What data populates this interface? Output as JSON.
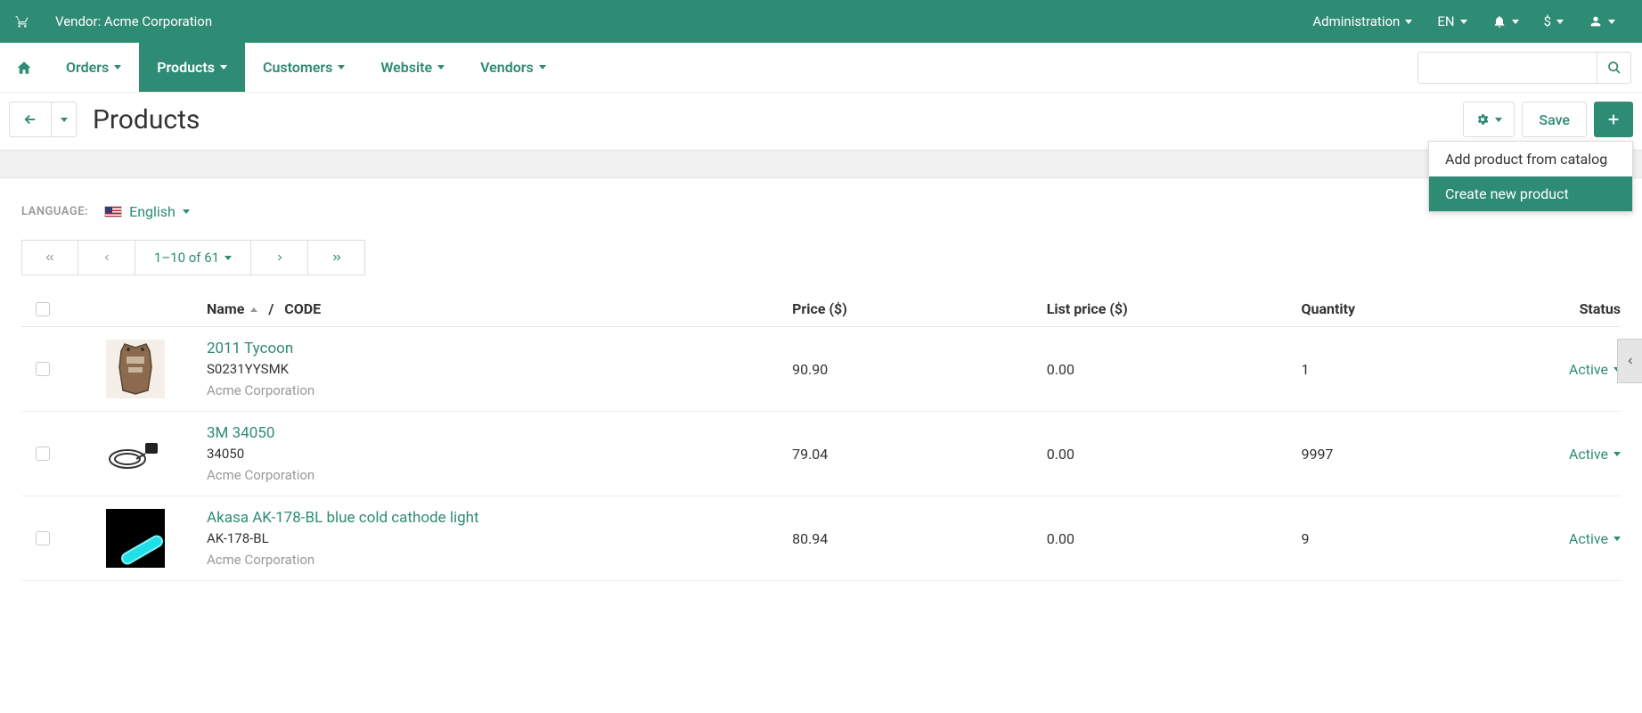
{
  "topbar": {
    "vendor_label": "Vendor: Acme Corporation",
    "administration": "Administration",
    "lang_short": "EN",
    "currency": "$"
  },
  "nav": {
    "orders": "Orders",
    "products": "Products",
    "customers": "Customers",
    "website": "Website",
    "vendors": "Vendors"
  },
  "page": {
    "title": "Products",
    "save": "Save"
  },
  "add_menu": {
    "from_catalog": "Add product from catalog",
    "create_new": "Create new product"
  },
  "language": {
    "label": "LANGUAGE:",
    "value": "English"
  },
  "pagination": {
    "range": "1–10 of 61"
  },
  "table": {
    "headers": {
      "name": "Name",
      "sep": "/",
      "code": "CODE",
      "price": "Price ($)",
      "list_price": "List price ($)",
      "quantity": "Quantity",
      "status": "Status"
    },
    "rows": [
      {
        "name": "2011 Tycoon",
        "code": "S0231YYSMK",
        "vendor": "Acme Corporation",
        "price": "90.90",
        "list_price": "0.00",
        "qty": "1",
        "status": "Active",
        "img_bg": "#f4efe8"
      },
      {
        "name": "3M 34050",
        "code": "34050",
        "vendor": "Acme Corporation",
        "price": "79.04",
        "list_price": "0.00",
        "qty": "9997",
        "status": "Active",
        "img_bg": "#ffffff"
      },
      {
        "name": "Akasa AK-178-BL blue cold cathode light",
        "code": "AK-178-BL",
        "vendor": "Acme Corporation",
        "price": "80.94",
        "list_price": "0.00",
        "qty": "9",
        "status": "Active",
        "img_bg": "#000000"
      }
    ]
  }
}
